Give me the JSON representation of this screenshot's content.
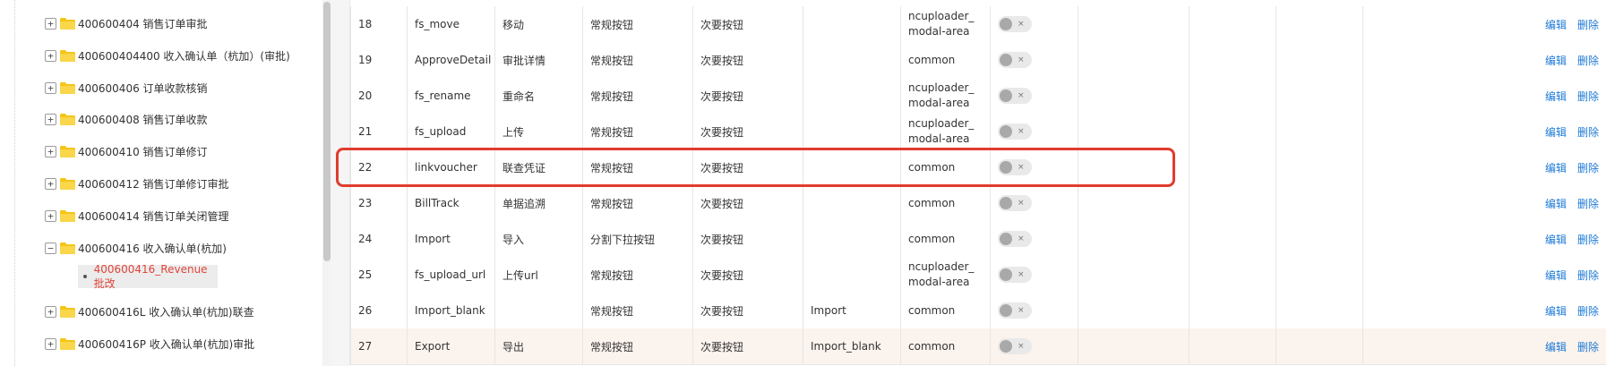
{
  "tree": {
    "nodes": [
      {
        "label": "400600404 销售订单审批",
        "expanded": false
      },
      {
        "label": "400600404400 收入确认单（杭加）(审批)",
        "expanded": false
      },
      {
        "label": "400600406 订单收款核销",
        "expanded": false
      },
      {
        "label": "400600408 销售订单收款",
        "expanded": false
      },
      {
        "label": "400600410 销售订单修订",
        "expanded": false
      },
      {
        "label": "400600412 销售订单修订审批",
        "expanded": false
      },
      {
        "label": "400600414 销售订单关闭管理",
        "expanded": false
      },
      {
        "label": "400600416 收入确认单(杭加)",
        "expanded": true
      },
      {
        "label": "400600416L 收入确认单(杭加)联查",
        "expanded": false
      },
      {
        "label": "400600416P 收入确认单(杭加)审批",
        "expanded": false
      }
    ],
    "selected_leaf": "400600416_Revenue 批改",
    "expand_symbol": "+",
    "collapse_symbol": "−"
  },
  "table": {
    "rows": [
      {
        "num": "18",
        "code": "fs_move",
        "name": "移动",
        "type": "常规按钮",
        "area": "次要按钮",
        "parent": "",
        "region": "ncuploader_modal-area"
      },
      {
        "num": "19",
        "code": "ApproveDetail",
        "name": "审批详情",
        "type": "常规按钮",
        "area": "次要按钮",
        "parent": "",
        "region": "common"
      },
      {
        "num": "20",
        "code": "fs_rename",
        "name": "重命名",
        "type": "常规按钮",
        "area": "次要按钮",
        "parent": "",
        "region": "ncuploader_modal-area"
      },
      {
        "num": "21",
        "code": "fs_upload",
        "name": "上传",
        "type": "常规按钮",
        "area": "次要按钮",
        "parent": "",
        "region": "ncuploader_modal-area"
      },
      {
        "num": "22",
        "code": "linkvoucher",
        "name": "联查凭证",
        "type": "常规按钮",
        "area": "次要按钮",
        "parent": "",
        "region": "common"
      },
      {
        "num": "23",
        "code": "BillTrack",
        "name": "单据追溯",
        "type": "常规按钮",
        "area": "次要按钮",
        "parent": "",
        "region": "common"
      },
      {
        "num": "24",
        "code": "Import",
        "name": "导入",
        "type": "分割下拉按钮",
        "area": "次要按钮",
        "parent": "",
        "region": "common"
      },
      {
        "num": "25",
        "code": "fs_upload_url",
        "name": "上传url",
        "type": "常规按钮",
        "area": "次要按钮",
        "parent": "",
        "region": "ncuploader_modal-area"
      },
      {
        "num": "26",
        "code": "Import_blank",
        "name": "",
        "type": "常规按钮",
        "area": "次要按钮",
        "parent": "Import",
        "region": "common"
      },
      {
        "num": "27",
        "code": "Export",
        "name": "导出",
        "type": "常规按钮",
        "area": "次要按钮",
        "parent": "Import_blank",
        "region": "common"
      }
    ],
    "toggle_off_mark": "×",
    "edit_label": "编辑",
    "delete_label": "删除"
  },
  "colors": {
    "accent_link": "#1e7ad6",
    "highlight_border": "#e03c2e",
    "selected_leaf_text": "#e0463a",
    "folder": "#f5c518"
  }
}
